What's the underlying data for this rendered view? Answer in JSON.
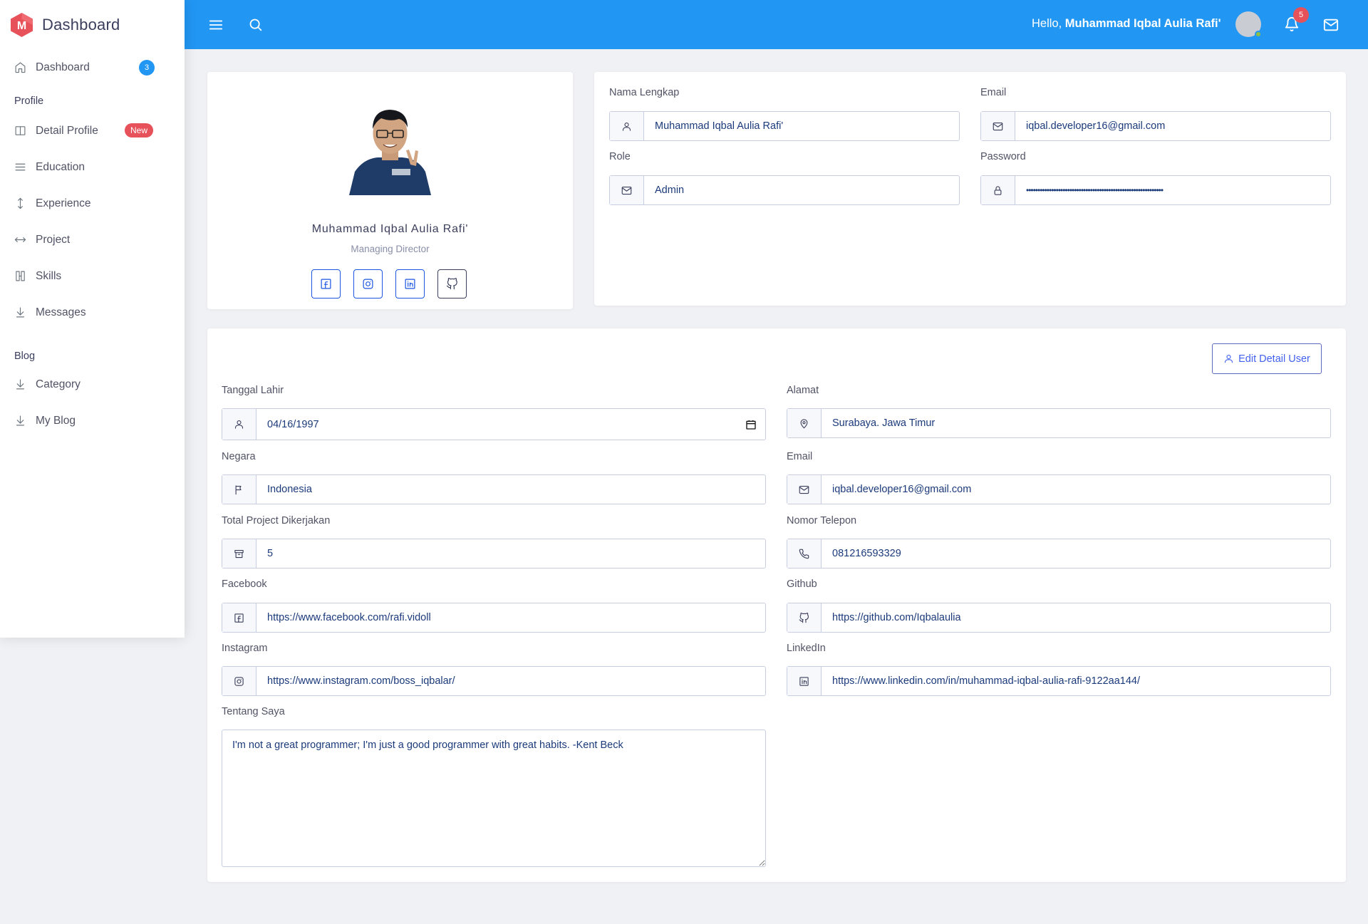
{
  "brand": {
    "name": "Dashboard",
    "logo_letter": "M",
    "logo_color": "#e7515a"
  },
  "sidebar": {
    "items": [
      {
        "label": "Dashboard",
        "icon": "home-icon",
        "badge": "3"
      },
      {
        "section": "Profile"
      },
      {
        "label": "Detail Profile",
        "icon": "columns-icon",
        "badge": "New"
      },
      {
        "label": "Education",
        "icon": "menu-icon"
      },
      {
        "label": "Experience",
        "icon": "arrow-up-down-icon"
      },
      {
        "label": "Project",
        "icon": "arrow-left-right-icon"
      },
      {
        "label": "Skills",
        "icon": "kanban-icon"
      },
      {
        "label": "Messages",
        "icon": "arrow-down-icon"
      },
      {
        "section": "Blog"
      },
      {
        "label": "Category",
        "icon": "arrow-down-icon"
      },
      {
        "label": "My Blog",
        "icon": "arrow-down-icon"
      }
    ]
  },
  "topbar": {
    "greeting": "Hello,",
    "user_name": "Muhammad Iqbal Aulia Rafi'",
    "notification_count": "5",
    "accent_color": "#2196f3"
  },
  "profile": {
    "name": "Muhammad Iqbal Aulia Rafi'",
    "role": "Managing Director",
    "social": [
      "facebook-icon",
      "instagram-icon",
      "linkedin-icon",
      "github-icon"
    ]
  },
  "account": {
    "full_name_label": "Nama Lengkap",
    "full_name": "Muhammad Iqbal Aulia Rafi'",
    "email_label": "Email",
    "email": "iqbal.developer16@gmail.com",
    "role_label": "Role",
    "role": "Admin",
    "password_label": "Password",
    "password": "••••••••••••••••••••••••••••••••••••••••••••••••••••••••••••"
  },
  "detail": {
    "edit_button": "Edit Detail User",
    "birth_label": "Tanggal Lahir",
    "birth": "04/16/1997",
    "address_label": "Alamat",
    "address": "Surabaya. Jawa Timur",
    "country_label": "Negara",
    "country": "Indonesia",
    "email_label": "Email",
    "email": "iqbal.developer16@gmail.com",
    "projects_label": "Total Project Dikerjakan",
    "projects": "5",
    "phone_label": "Nomor Telepon",
    "phone": "081216593329",
    "facebook_label": "Facebook",
    "facebook": "https://www.facebook.com/rafi.vidoll",
    "github_label": "Github",
    "github": "https://github.com/Iqbalaulia",
    "instagram_label": "Instagram",
    "instagram": "https://www.instagram.com/boss_iqbalar/",
    "linkedin_label": "LinkedIn",
    "linkedin": "https://www.linkedin.com/in/muhammad-iqbal-aulia-rafi-9122aa144/",
    "about_label": "Tentang Saya",
    "about": "I'm not a great programmer; I'm just a good programmer with great habits. -Kent Beck"
  }
}
